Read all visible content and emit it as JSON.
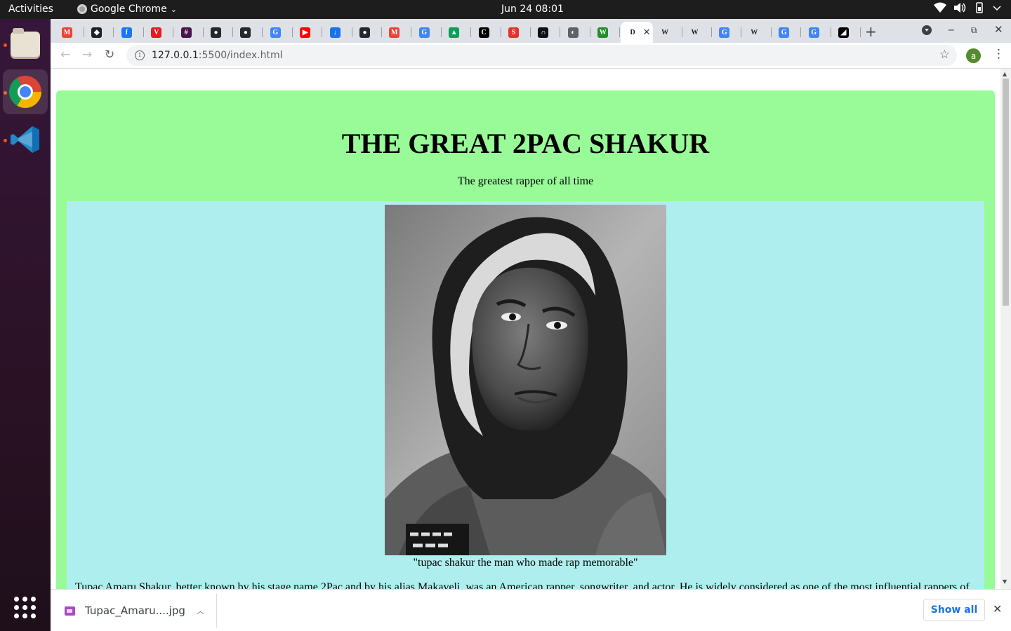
{
  "system": {
    "activities_label": "Activities",
    "app_menu_label": "Google Chrome",
    "clock": "Jun 24  08:01"
  },
  "browser": {
    "tabs": [
      {
        "icon": "gmail-icon",
        "color": "#ea4335",
        "glyph": "M"
      },
      {
        "icon": "codepen-icon",
        "color": "#202124",
        "glyph": "◆"
      },
      {
        "icon": "facebook-icon",
        "color": "#1877f2",
        "glyph": "f"
      },
      {
        "icon": "vivaldi-icon",
        "color": "#e01e1e",
        "glyph": "V"
      },
      {
        "icon": "slack-icon",
        "color": "#4a154b",
        "glyph": "#"
      },
      {
        "icon": "github-icon",
        "color": "#24292e",
        "glyph": "●"
      },
      {
        "icon": "github-icon",
        "color": "#24292e",
        "glyph": "●"
      },
      {
        "icon": "google-icon",
        "color": "#4285f4",
        "glyph": "G"
      },
      {
        "icon": "youtube-icon",
        "color": "#ff0000",
        "glyph": "▶"
      },
      {
        "icon": "download-icon",
        "color": "#1a73e8",
        "glyph": "↓"
      },
      {
        "icon": "github-icon",
        "color": "#24292e",
        "glyph": "●"
      },
      {
        "icon": "gmail-icon",
        "color": "#ea4335",
        "glyph": "M"
      },
      {
        "icon": "google-icon",
        "color": "#4285f4",
        "glyph": "G"
      },
      {
        "icon": "google-drive-icon",
        "color": "#0f9d58",
        "glyph": "▲"
      },
      {
        "icon": "codecademy-icon",
        "color": "#000000",
        "glyph": "C"
      },
      {
        "icon": "scribd-icon",
        "color": "#e0362a",
        "glyph": "S"
      },
      {
        "icon": "terminal-icon",
        "color": "#0d1117",
        "glyph": "∩"
      },
      {
        "icon": "globe-icon",
        "color": "#5f6368",
        "glyph": "◐"
      },
      {
        "icon": "wikihow-icon",
        "color": "#258f2b",
        "glyph": "W"
      },
      {
        "icon": "document-icon",
        "color": "#ffffff",
        "glyph": "D",
        "active": true
      },
      {
        "icon": "wikipedia-icon",
        "color": "#ffffff",
        "glyph": "W"
      },
      {
        "icon": "wikipedia-icon",
        "color": "#ffffff",
        "glyph": "W"
      },
      {
        "icon": "google-icon",
        "color": "#4285f4",
        "glyph": "G"
      },
      {
        "icon": "wikipedia-icon",
        "color": "#ffffff",
        "glyph": "W"
      },
      {
        "icon": "google-icon",
        "color": "#4285f4",
        "glyph": "G"
      },
      {
        "icon": "google-icon",
        "color": "#4285f4",
        "glyph": "G"
      },
      {
        "icon": "replit-icon",
        "color": "#000000",
        "glyph": "◢"
      }
    ],
    "address": {
      "host": "127.0.0.1",
      "rest": ":5500/index.html"
    },
    "profile_initial": "a"
  },
  "page": {
    "title": "THE GREAT 2PAC SHAKUR",
    "subtitle": "The greatest rapper of all time",
    "caption": "\"tupac shakur the man who made rap memorable\"",
    "body_text_fragment": "Tupac Amaru Shakur, better known by his stage name 2Pac and by his alias Makaveli, was an American rapper, songwriter, and actor. He is widely considered as one of the most influential rappers of"
  },
  "downloads": {
    "file_name": "Tupac_Amaru....jpg",
    "show_all_label": "Show all"
  }
}
